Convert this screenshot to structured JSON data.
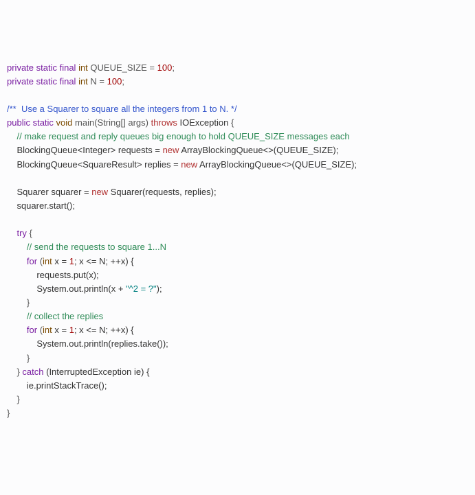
{
  "code": {
    "l01": {
      "mod": "private static final",
      "type": "int",
      "name": "QUEUE_SIZE",
      "eq": " = ",
      "val": "100",
      "semi": ";"
    },
    "l02": {
      "mod": "private static final",
      "type": "int",
      "name": "N",
      "eq": " = ",
      "val": "100",
      "semi": ";"
    },
    "l04": {
      "doc": "/**  Use a Squarer to square all the integers from 1 to N. */"
    },
    "l05": {
      "mod": "public static",
      "type": "void",
      "name": "main",
      "args": "(String[] args)",
      "throws": "throws",
      "exc": "IOException",
      "open": " {"
    },
    "l06": {
      "cmt": "// make request and reply queues big enough to hold QUEUE_SIZE messages each"
    },
    "l07": {
      "a": "BlockingQueue<Integer> requests = ",
      "new": "new",
      "b": " ArrayBlockingQueue<>(QUEUE_SIZE);"
    },
    "l08": {
      "a": "BlockingQueue<SquareResult> replies = ",
      "new": "new",
      "b": " ArrayBlockingQueue<>(QUEUE_SIZE);"
    },
    "l10": {
      "a": "Squarer squarer = ",
      "new": "new",
      "b": " Squarer(requests, replies);"
    },
    "l11": {
      "a": "squarer.start();"
    },
    "l13": {
      "try": "try",
      "open": " {"
    },
    "l14": {
      "cmt": "// send the requests to square 1...N"
    },
    "l15": {
      "for": "for",
      "a": " (",
      "type": "int",
      "b": " x = ",
      "one": "1",
      "c": "; x <= N; ++x) {"
    },
    "l16": {
      "a": "requests.put(x);"
    },
    "l17": {
      "a": "System.out.println(x + ",
      "str": "\"^2 = ?\"",
      "b": ");"
    },
    "l18": {
      "a": "}"
    },
    "l19": {
      "cmt": "// collect the replies"
    },
    "l20": {
      "for": "for",
      "a": " (",
      "type": "int",
      "b": " x = ",
      "one": "1",
      "c": "; x <= N; ++x) {"
    },
    "l21": {
      "a": "System.out.println(replies.take());"
    },
    "l22": {
      "a": "}"
    },
    "l23": {
      "a": "} ",
      "catch": "catch",
      "b": " (InterruptedException ie) {"
    },
    "l24": {
      "a": "ie.printStackTrace();"
    },
    "l25": {
      "a": "}"
    },
    "l26": {
      "a": "}"
    }
  }
}
